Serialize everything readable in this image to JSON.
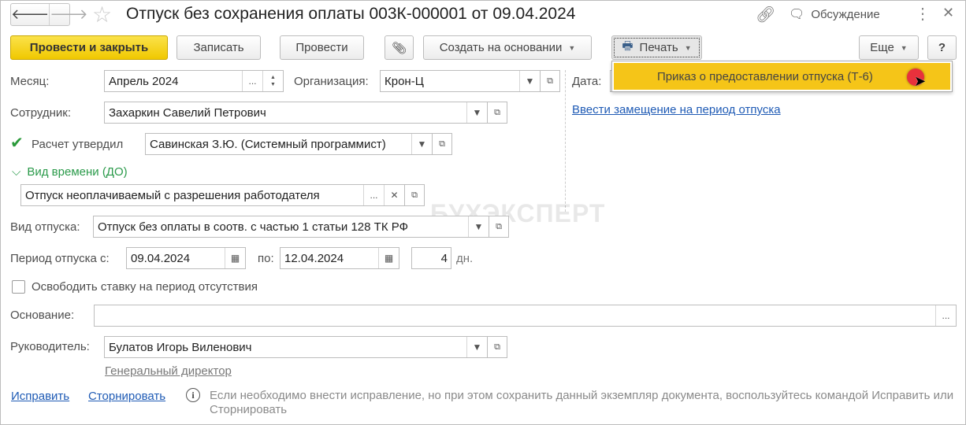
{
  "title": "Отпуск без сохранения оплаты 003К-000001 от 09.04.2024",
  "header": {
    "discussion": "Обсуждение"
  },
  "toolbar": {
    "post_close": "Провести и закрыть",
    "save": "Записать",
    "post": "Провести",
    "create_based": "Создать на основании",
    "print": "Печать",
    "more": "Еще",
    "help": "?"
  },
  "print_menu": {
    "items": [
      "Приказ о предоставлении отпуска (Т-6)"
    ]
  },
  "form": {
    "month_label": "Месяц:",
    "month": "Апрель 2024",
    "org_label": "Организация:",
    "org": "Крон-Ц",
    "date_label": "Дата:",
    "substitution_link": "Ввести замещение на период отпуска",
    "employee_label": "Сотрудник:",
    "employee": "Захаркин Савелий Петрович",
    "approved_label": "Расчет утвердил",
    "approved_checked": true,
    "approved_by": "Савинская З.Ю. (Системный программист)",
    "time_type_label": "Вид времени (ДО)",
    "time_type": "Отпуск неоплачиваемый с разрешения работодателя",
    "leave_type_label": "Вид отпуска:",
    "leave_type": "Отпуск без оплаты в соотв. с частью 1 статьи 128 ТК РФ",
    "period_label": "Период отпуска с:",
    "period_from": "09.04.2024",
    "period_to_label": "по:",
    "period_to": "12.04.2024",
    "days": "4",
    "days_unit": "дн.",
    "release_rate_label": "Освободить ставку на период отсутствия",
    "release_rate_checked": false,
    "basis_label": "Основание:",
    "basis": "",
    "head_label": "Руководитель:",
    "head": "Булатов Игорь Виленович",
    "head_position": "Генеральный директор"
  },
  "footer": {
    "fix": "Исправить",
    "reverse": "Сторнировать",
    "info": "Если необходимо внести исправление, но при этом сохранить данный экземпляр документа, воспользуйтесь командой Исправить или Сторнировать"
  },
  "watermark": "БУХЭКСПЕРТ"
}
